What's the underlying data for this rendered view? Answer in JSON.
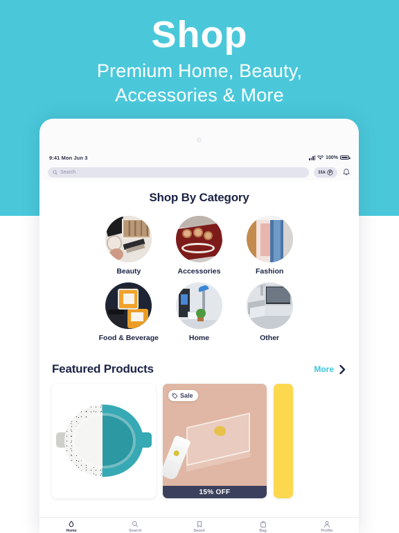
{
  "hero": {
    "title": "Shop",
    "subtitle_line1": "Premium Home, Beauty,",
    "subtitle_line2": "Accessories & More"
  },
  "status_bar": {
    "time_date": "9:41 Mon Jun 3",
    "battery_percent": "100%",
    "signal_icon": "cellular-signal-icon",
    "wifi_icon": "wifi-icon",
    "battery_icon": "battery-full-icon"
  },
  "search": {
    "placeholder": "Search",
    "icon": "search-icon"
  },
  "points": {
    "value": "31k",
    "icon": "points-coin-icon"
  },
  "notifications": {
    "icon": "bell-icon"
  },
  "categories": {
    "section_title": "Shop By Category",
    "items": [
      {
        "label": "Beauty",
        "image": "beauty-makeup-palette-photo"
      },
      {
        "label": "Accessories",
        "image": "accessories-rings-bracelet-photo"
      },
      {
        "label": "Fashion",
        "image": "fashion-clothing-rack-photo"
      },
      {
        "label": "Food & Beverage",
        "image": "food-jars-photo"
      },
      {
        "label": "Home",
        "image": "home-interior-lamp-plant-photo"
      },
      {
        "label": "Other",
        "image": "other-desk-computer-photo"
      }
    ]
  },
  "featured": {
    "title": "Featured Products",
    "more_label": "More",
    "more_chevron": "chevron-right-icon",
    "cards": [
      {
        "name": "speckled-teal-pot",
        "badge": "",
        "promo": ""
      },
      {
        "name": "glass-tray-skincare",
        "badge": "Sale",
        "badge_icon": "tag-icon",
        "promo": "15% OFF"
      },
      {
        "name": "yellow-product-card",
        "badge": "",
        "promo": ""
      }
    ]
  },
  "tabbar": {
    "items": [
      {
        "label": "Home",
        "icon": "home-flame-icon",
        "active": true
      },
      {
        "label": "Search",
        "icon": "search-icon",
        "active": false
      },
      {
        "label": "Saved",
        "icon": "bookmark-icon",
        "active": false
      },
      {
        "label": "Bag",
        "icon": "shopping-bag-icon",
        "active": false
      },
      {
        "label": "Profile",
        "icon": "person-icon",
        "active": false
      }
    ]
  },
  "colors": {
    "brand_teal": "#4ac8da",
    "accent_teal": "#3fc4dc",
    "navy": "#1b2344",
    "promo_navy": "#3b405c",
    "yellow": "#fcd84f"
  }
}
